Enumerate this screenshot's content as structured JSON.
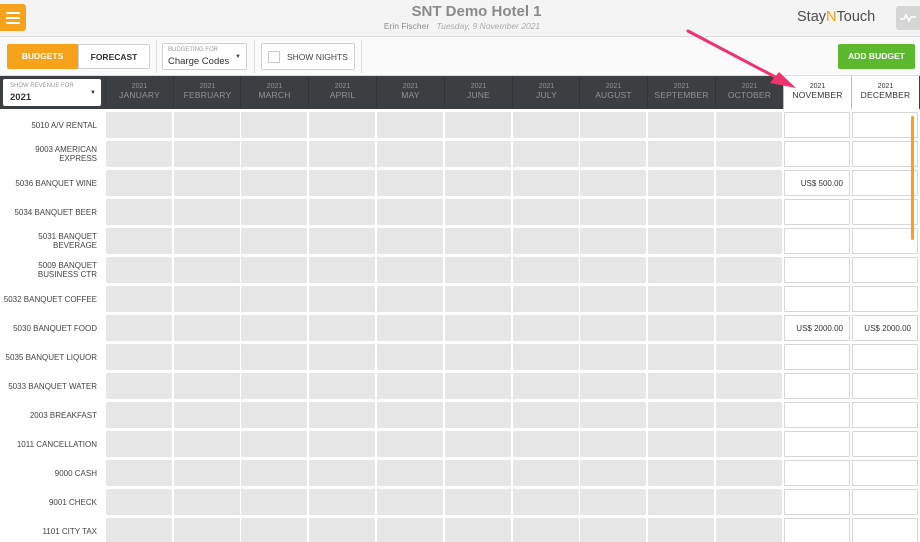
{
  "header": {
    "hotel_name": "SNT Demo Hotel 1",
    "user": "Erin Fischer",
    "date": "Tuesday, 9 November 2021",
    "logo_pre": "Stay",
    "logo_n": "N",
    "logo_post": "Touch"
  },
  "toolbar": {
    "budgets_label": "BUDGETS",
    "forecast_label": "FORECAST",
    "budgeting_for_label": "BUDGETING FOR",
    "budgeting_for_value": "Charge Codes",
    "show_nights_label": "SHOW NIGHTS",
    "add_budget_label": "ADD BUDGET"
  },
  "revenue_select": {
    "label": "SHOW REVENUE FOR",
    "value": "2021"
  },
  "months": [
    {
      "year": "2021",
      "name": "JANUARY"
    },
    {
      "year": "2021",
      "name": "FEBRUARY"
    },
    {
      "year": "2021",
      "name": "MARCH"
    },
    {
      "year": "2021",
      "name": "APRIL"
    },
    {
      "year": "2021",
      "name": "MAY"
    },
    {
      "year": "2021",
      "name": "JUNE"
    },
    {
      "year": "2021",
      "name": "JULY"
    },
    {
      "year": "2021",
      "name": "AUGUST"
    },
    {
      "year": "2021",
      "name": "SEPTEMBER"
    },
    {
      "year": "2021",
      "name": "OCTOBER"
    },
    {
      "year": "2021",
      "name": "NOVEMBER"
    },
    {
      "year": "2021",
      "name": "DECEMBER"
    }
  ],
  "rows": [
    {
      "label": [
        "5010 A/V RENTAL"
      ],
      "november": "",
      "december": ""
    },
    {
      "label": [
        "9003 AMERICAN",
        "EXPRESS"
      ],
      "november": "",
      "december": ""
    },
    {
      "label": [
        "5036 BANQUET WINE"
      ],
      "november": "US$ 500.00",
      "december": ""
    },
    {
      "label": [
        "5034 BANQUET BEER"
      ],
      "november": "",
      "december": ""
    },
    {
      "label": [
        "5031 BANQUET",
        "BEVERAGE"
      ],
      "november": "",
      "december": ""
    },
    {
      "label": [
        "5009 BANQUET",
        "BUSINESS CTR"
      ],
      "november": "",
      "december": ""
    },
    {
      "label": [
        "5032 BANQUET COFFEE"
      ],
      "november": "",
      "december": ""
    },
    {
      "label": [
        "5030 BANQUET FOOD"
      ],
      "november": "US$ 2000.00",
      "december": "US$ 2000.00"
    },
    {
      "label": [
        "5035 BANQUET LIQUOR"
      ],
      "november": "",
      "december": ""
    },
    {
      "label": [
        "5033 BANQUET WATER"
      ],
      "november": "",
      "december": ""
    },
    {
      "label": [
        "2003 BREAKFAST"
      ],
      "november": "",
      "december": ""
    },
    {
      "label": [
        "1011 CANCELLATION"
      ],
      "november": "",
      "december": ""
    },
    {
      "label": [
        "9000 CASH"
      ],
      "november": "",
      "december": ""
    },
    {
      "label": [
        "9001 CHECK"
      ],
      "november": "",
      "december": ""
    },
    {
      "label": [
        "1101 CITY TAX"
      ],
      "november": "",
      "december": ""
    }
  ],
  "colors": {
    "accent": "#f7a21b",
    "add_button": "#5cb82e",
    "header_dark": "#3c3f42",
    "annotation_arrow": "#f0336e"
  }
}
